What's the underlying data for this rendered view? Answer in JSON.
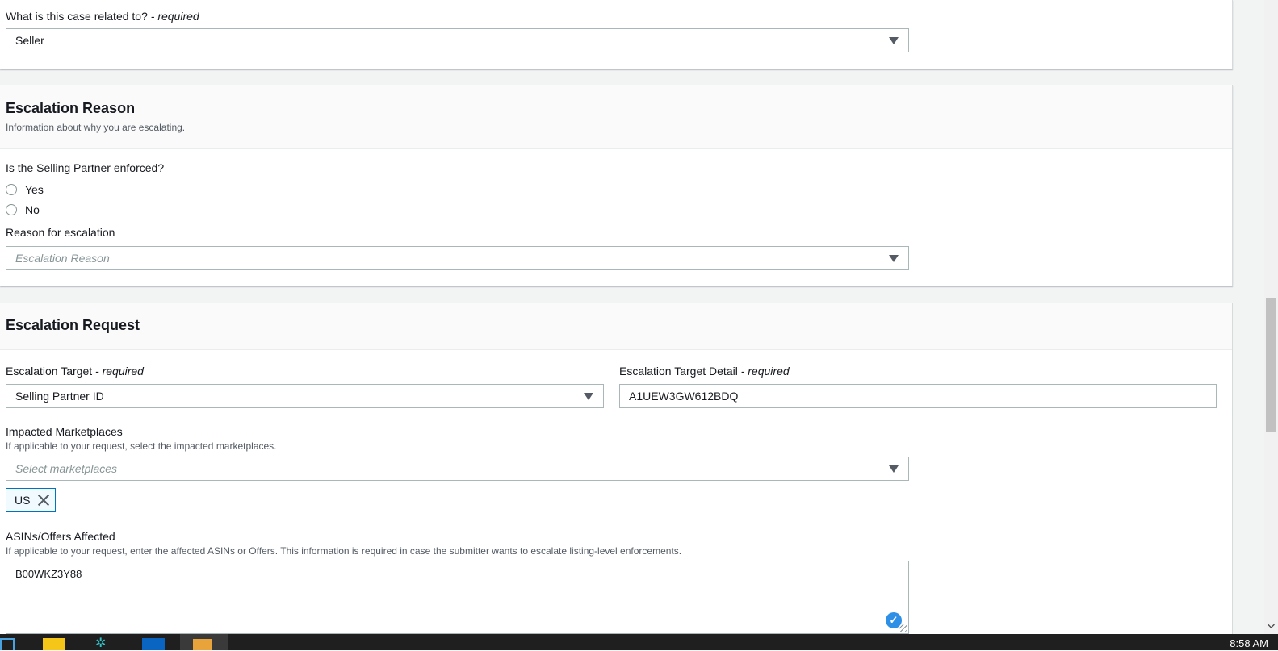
{
  "case_related": {
    "label": "What is this case related to?",
    "required_text": "- required",
    "value": "Seller"
  },
  "escalation_reason": {
    "title": "Escalation Reason",
    "description": "Information about why you are escalating.",
    "enforced_question": "Is the Selling Partner enforced?",
    "options": [
      "Yes",
      "No"
    ],
    "reason_label": "Reason for escalation",
    "reason_placeholder": "Escalation Reason"
  },
  "escalation_request": {
    "title": "Escalation Request",
    "target_label": "Escalation Target",
    "target_required": "- required",
    "target_value": "Selling Partner ID",
    "detail_label": "Escalation Target Detail",
    "detail_required": "- required",
    "detail_value": "A1UEW3GW612BDQ",
    "marketplaces_label": "Impacted Marketplaces",
    "marketplaces_desc": "If applicable to your request, select the impacted marketplaces.",
    "marketplaces_placeholder": "Select marketplaces",
    "marketplace_token": "US",
    "asins_label": "ASINs/Offers Affected",
    "asins_desc": "If applicable to your request, enter the affected ASINs or Offers. This information is required in case the submitter wants to escalate listing-level enforcements.",
    "asins_value": "B00WKZ3Y88"
  },
  "taskbar": {
    "clock": "8:58 AM"
  },
  "colors": {
    "accent_blue": "#0073bb",
    "page_bg": "#f2f3f3",
    "taskbar_bg": "#1f1f1f"
  }
}
